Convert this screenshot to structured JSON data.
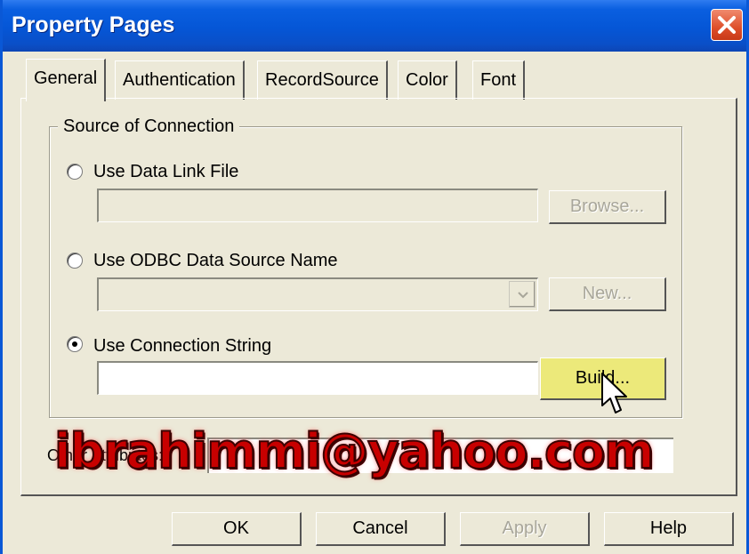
{
  "window": {
    "title": "Property Pages"
  },
  "tabs": [
    {
      "label": "General",
      "active": true
    },
    {
      "label": "Authentication",
      "active": false
    },
    {
      "label": "RecordSource",
      "active": false
    },
    {
      "label": "Color",
      "active": false
    },
    {
      "label": "Font",
      "active": false
    }
  ],
  "group": {
    "legend": "Source of Connection",
    "options": [
      {
        "label": "Use Data Link File",
        "selected": false
      },
      {
        "label": "Use ODBC Data Source Name",
        "selected": false
      },
      {
        "label": "Use Connection String",
        "selected": true
      }
    ],
    "browse_label": "Browse...",
    "new_label": "New...",
    "build_label": "Build..."
  },
  "other": {
    "label": "Other Attributes:"
  },
  "watermark": {
    "text": "ibrahimmi@yahoo.com"
  },
  "footer": {
    "ok_label": "OK",
    "cancel_label": "Cancel",
    "apply_label": "Apply",
    "help_label": "Help"
  },
  "icons": {
    "close": "close-x-icon",
    "dropdown": "chevron-down-icon",
    "cursor": "mouse-pointer-icon"
  },
  "colors": {
    "title_bar": "#0556d6",
    "close_button": "#de4e2a",
    "dialog_face": "#ece9d8",
    "hover_button": "#ece97a",
    "watermark": "#c80000"
  }
}
